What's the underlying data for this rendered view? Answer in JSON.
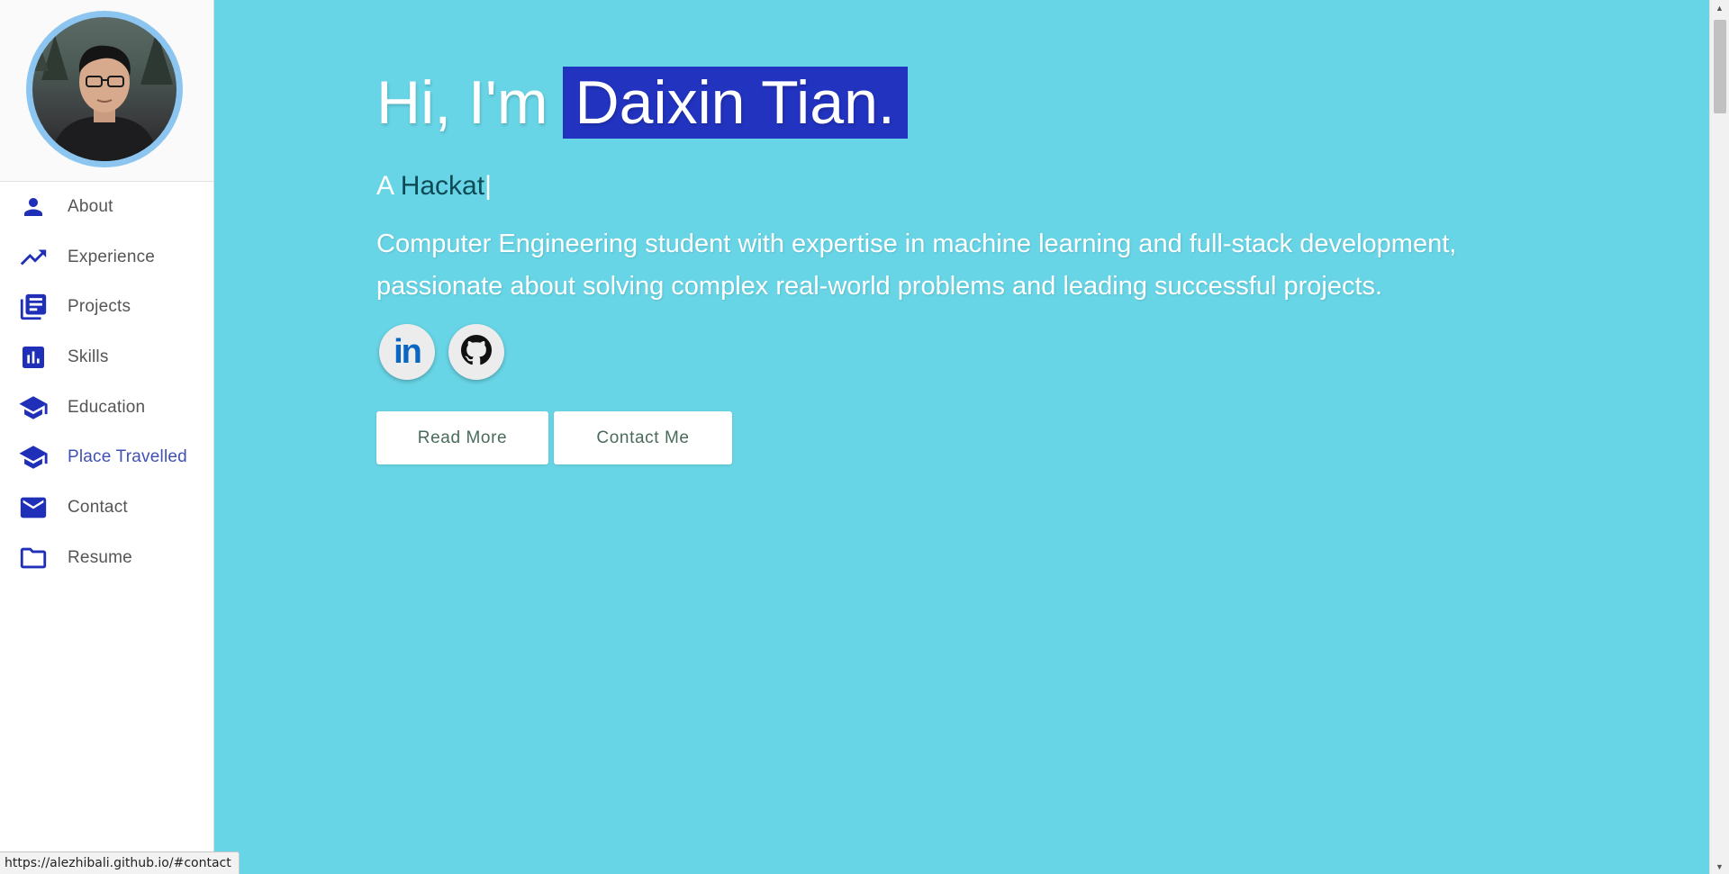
{
  "colors": {
    "main_background": "#68d5e6",
    "accent": "#2233c0",
    "nav_icon": "#1f2fb8",
    "nav_active": "#3f51b5",
    "avatar_ring": "#8cc6f0",
    "linkedin": "#0a66c2"
  },
  "sidebar": {
    "items": [
      {
        "label": "About",
        "icon": "person-icon"
      },
      {
        "label": "Experience",
        "icon": "trending-up-icon"
      },
      {
        "label": "Projects",
        "icon": "library-books-icon"
      },
      {
        "label": "Skills",
        "icon": "bar-chart-icon"
      },
      {
        "label": "Education",
        "icon": "graduation-cap-icon"
      },
      {
        "label": "Place Travelled",
        "icon": "graduation-cap-icon",
        "active": true
      },
      {
        "label": "Contact",
        "icon": "mail-icon"
      },
      {
        "label": "Resume",
        "icon": "folder-icon"
      }
    ]
  },
  "hero": {
    "greeting": "Hi, I'm",
    "name": "Daixin Tian.",
    "subtitle_prefix": "A",
    "subtitle_typed": "Hackat",
    "subtitle_cursor": "|",
    "bio": "Computer Engineering student with expertise in machine learning and full-stack development, passionate about solving complex real-world problems and leading successful projects.",
    "social": [
      {
        "name": "linkedin",
        "text": "in",
        "icon": "linkedin-icon"
      },
      {
        "name": "github",
        "icon": "github-icon"
      }
    ],
    "buttons": {
      "read_more": "Read More",
      "contact_me": "Contact Me"
    }
  },
  "status_bar": {
    "url": "https://alezhibali.github.io/#contact"
  }
}
